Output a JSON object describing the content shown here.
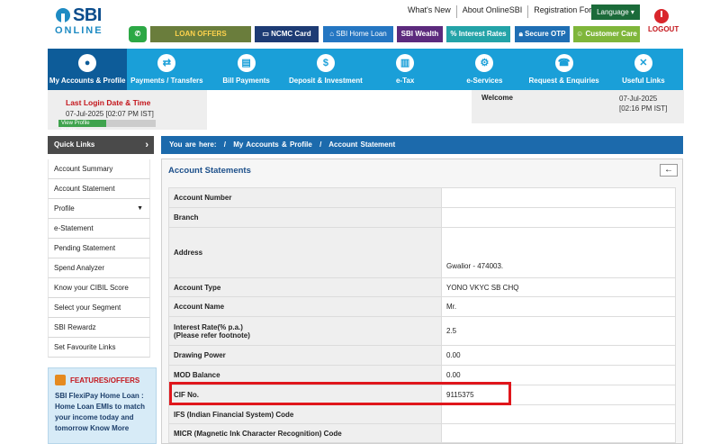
{
  "brand": {
    "name": "SBI",
    "sub": "ONLINE"
  },
  "top_links": [
    "What's New",
    "About OnlineSBI",
    "Registration Forms"
  ],
  "language": "Language ▾",
  "logout": "LOGOUT",
  "banners": [
    {
      "label": "",
      "icon": "whatsapp-icon",
      "color": "#2ca845"
    },
    {
      "label": "LOAN OFFERS",
      "icon": "loan-offers-banner",
      "color": "#6a7d3c"
    },
    {
      "label": "NCMC Card",
      "icon": "ncmc-card-icon",
      "color": "#1d3b74"
    },
    {
      "label": "SBI Home Loan",
      "icon": "home-icon",
      "color": "#2476c2"
    },
    {
      "label": "SBI Wealth",
      "icon": "wealth-icon",
      "color": "#5c2a7d"
    },
    {
      "label": "Interest Rates",
      "icon": "percent-icon",
      "color": "#23a3a8"
    },
    {
      "label": "Secure OTP",
      "icon": "lock-icon",
      "color": "#1f6fb4"
    },
    {
      "label": "Customer Care",
      "icon": "headset-icon",
      "color": "#7fb63a"
    }
  ],
  "nav": [
    {
      "label": "My Accounts & Profile",
      "icon": "user-icon",
      "glyph": "●"
    },
    {
      "label": "Payments / Transfers",
      "icon": "transfer-icon",
      "glyph": "⇄"
    },
    {
      "label": "Bill Payments",
      "icon": "bill-icon",
      "glyph": "▤"
    },
    {
      "label": "Deposit & Investment",
      "icon": "investment-icon",
      "glyph": "$"
    },
    {
      "label": "e-Tax",
      "icon": "tax-icon",
      "glyph": "▥"
    },
    {
      "label": "e-Services",
      "icon": "services-icon",
      "glyph": "⚙"
    },
    {
      "label": "Request & Enquiries",
      "icon": "phone-icon",
      "glyph": "☎"
    },
    {
      "label": "Useful Links",
      "icon": "links-icon",
      "glyph": "✕"
    }
  ],
  "last_login": {
    "title": "Last Login Date & Time",
    "value": "07-Jul-2025 [02:07 PM IST]",
    "profile_status": "View Profile Status"
  },
  "welcome": {
    "label": "Welcome",
    "date": "07-Jul-2025",
    "time": "[02:16 PM IST]"
  },
  "quick_links": {
    "title": "Quick Links"
  },
  "left_menu": [
    "Account Summary",
    "Account Statement",
    "Profile",
    "e-Statement",
    "Pending Statement",
    "Spend Analyzer",
    "Know your CIBIL Score",
    "Select your Segment",
    "SBI Rewardz",
    "Set Favourite Links"
  ],
  "features": {
    "title": "FEATURES/OFFERS",
    "text": "SBI FlexiPay Home Loan : Home Loan EMIs to match your income today and tomorrow Know More"
  },
  "breadcrumb": {
    "prefix": "You are here:",
    "sep": "/",
    "level1": "My Accounts & Profile",
    "level2": "Account Statement"
  },
  "panel": {
    "title": "Account Statements",
    "back": "←"
  },
  "details": [
    {
      "label": "Account Number",
      "value": ""
    },
    {
      "label": "Branch",
      "value": ""
    },
    {
      "label": "Address",
      "value": "Gwalior  - 474003."
    },
    {
      "label": "Account Type",
      "value": "YONO VKYC SB CHQ"
    },
    {
      "label": "Account Name",
      "value": "Mr."
    },
    {
      "label": "Interest Rate(% p.a.)",
      "label2": "(Please refer footnote)",
      "value": "2.5"
    },
    {
      "label": "Drawing Power",
      "value": "0.00"
    },
    {
      "label": "MOD Balance",
      "value": "0.00"
    },
    {
      "label": "CIF No.",
      "value": "9115375"
    },
    {
      "label": "IFS (Indian Financial System) Code",
      "value": ""
    },
    {
      "label": "MICR (Magnetic Ink Character Recognition) Code",
      "value": ""
    }
  ]
}
